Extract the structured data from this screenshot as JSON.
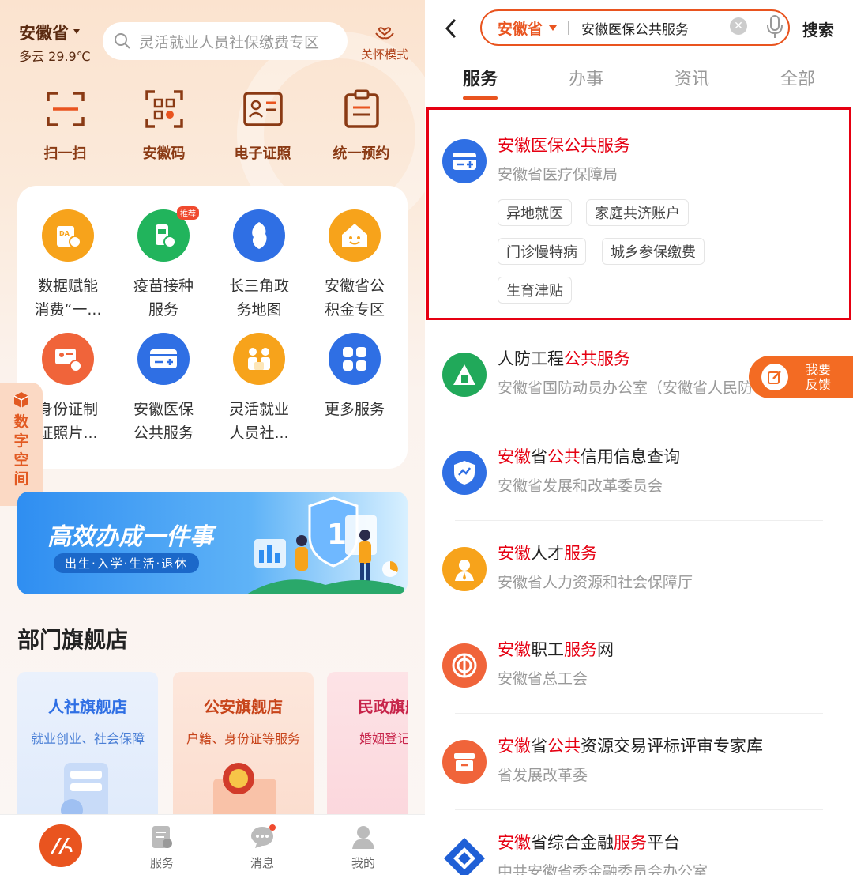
{
  "left": {
    "location": {
      "province": "安徽省",
      "weather": "多云 29.9℃"
    },
    "search_placeholder": "灵活就业人员社保缴费专区",
    "care_mode": "关怀模式",
    "quick_actions": [
      {
        "label": "扫一扫",
        "icon": "scan-icon"
      },
      {
        "label": "安徽码",
        "icon": "qrcode-icon"
      },
      {
        "label": "电子证照",
        "icon": "id-card-icon"
      },
      {
        "label": "统一预约",
        "icon": "appointment-icon"
      }
    ],
    "services": [
      {
        "line1": "数据赋能",
        "line2": "消费“一...",
        "icon": "data-icon",
        "color": "#f7a31b"
      },
      {
        "line1": "疫苗接种",
        "line2": "服务",
        "icon": "vaccine-icon",
        "color": "#21b45c",
        "badge": "推荐"
      },
      {
        "line1": "长三角政",
        "line2": "务地图",
        "icon": "map-icon",
        "color": "#2f6fe4"
      },
      {
        "line1": "安徽省公",
        "line2": "积金专区",
        "icon": "house-icon",
        "color": "#f7a31b"
      },
      {
        "line1": "身份证制",
        "line2": "证照片...",
        "icon": "id-photo-icon",
        "color": "#f0643a"
      },
      {
        "line1": "安徽医保",
        "line2": "公共服务",
        "icon": "medical-card-icon",
        "color": "#2f6fe4"
      },
      {
        "line1": "灵活就业",
        "line2": "人员社...",
        "icon": "people-icon",
        "color": "#f7a31b"
      },
      {
        "line1": "更多服务",
        "line2": "",
        "icon": "more-icon",
        "color": "#2f6fe4"
      }
    ],
    "side_tab": [
      "数",
      "字",
      "空",
      "间"
    ],
    "banner": {
      "title": "高效办成一件事",
      "subtitle": "出生·入学·生活·退休"
    },
    "section_title": "部门旗舰店",
    "stores": [
      {
        "name": "人社旗舰店",
        "desc": "就业创业、社会保障"
      },
      {
        "name": "公安旗舰店",
        "desc": "户籍、身份证等服务"
      },
      {
        "name": "民政旗舰店",
        "desc": "婚姻登记预约"
      }
    ],
    "tabbar": [
      {
        "label": "服务",
        "icon": "service-icon"
      },
      {
        "label": "消息",
        "icon": "message-icon"
      },
      {
        "label": "我的",
        "icon": "profile-icon"
      }
    ]
  },
  "right": {
    "search": {
      "province": "安徽省",
      "query": "安徽医保公共服务",
      "button": "搜索"
    },
    "tabs": [
      "服务",
      "办事",
      "资讯",
      "全部"
    ],
    "results": [
      {
        "title": [
          [
            "安徽医保公共服务",
            true
          ]
        ],
        "sub": "安徽省医疗保障局",
        "icon": "medical-card-icon",
        "color": "#2f6fe4",
        "tags": [
          "异地就医",
          "家庭共济账户",
          "门诊慢特病",
          "城乡参保缴费",
          "生育津贴"
        ]
      },
      {
        "title": [
          [
            "人防工程",
            false
          ],
          [
            "公共服务",
            true
          ]
        ],
        "sub": "安徽省国防动员办公室（安徽省人民防",
        "icon": "shelter-icon",
        "color": "#21a95a"
      },
      {
        "title": [
          [
            "安徽",
            true
          ],
          [
            "省",
            false
          ],
          [
            "公共",
            true
          ],
          [
            "信用信息查询",
            false
          ]
        ],
        "sub": "安徽省发展和改革委员会",
        "icon": "shield-chart-icon",
        "color": "#2f6fe4"
      },
      {
        "title": [
          [
            "安徽",
            true
          ],
          [
            "人才",
            false
          ],
          [
            "服务",
            true
          ]
        ],
        "sub": "安徽省人力资源和社会保障厅",
        "icon": "talent-icon",
        "color": "#f7a31b"
      },
      {
        "title": [
          [
            "安徽",
            true
          ],
          [
            "职工",
            false
          ],
          [
            "服务",
            true
          ],
          [
            "网",
            false
          ]
        ],
        "sub": "安徽省总工会",
        "icon": "union-icon",
        "color": "#f0643a"
      },
      {
        "title": [
          [
            "安徽",
            true
          ],
          [
            "省",
            false
          ],
          [
            "公共",
            true
          ],
          [
            "资源交易评标评审专家库",
            false
          ]
        ],
        "sub": "省发展改革委",
        "icon": "archive-icon",
        "color": "#f0643a"
      },
      {
        "title": [
          [
            "安徽",
            true
          ],
          [
            "省综合金融",
            false
          ],
          [
            "服务",
            true
          ],
          [
            "平台",
            false
          ]
        ],
        "sub": "中共安徽省委金融委员会办公室",
        "icon": "finance-icon",
        "color": "#1f5fd6"
      }
    ],
    "feedback": {
      "line1": "我要",
      "line2": "反馈"
    }
  }
}
